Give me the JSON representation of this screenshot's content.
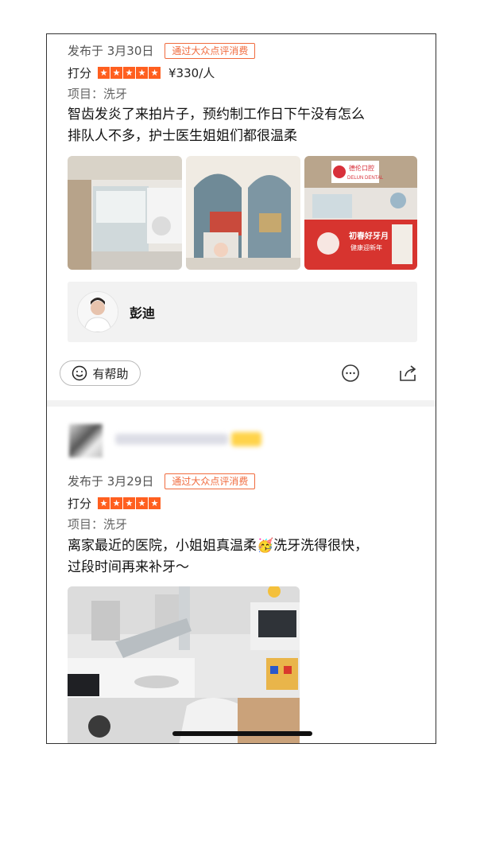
{
  "review1": {
    "date": "发布于 3月30日",
    "source_tag": "通过大众点评消费",
    "score_label": "打分",
    "stars": 5,
    "price": "¥330/人",
    "item": "项目：洗牙",
    "text_line1": "智齿发炎了来拍片子，预约制工作日下午没有怎么",
    "text_line2": "排队人不多，护士医生姐姐们都很温柔",
    "doctor_name": "彭迪",
    "helpful_label": "有帮助",
    "photo_sign_text1": "德伦口腔",
    "photo_sign_text2": "DELUN DENTAL",
    "photo_banner_text1": "初春好牙月",
    "photo_banner_text2": "健康迎新年"
  },
  "review2": {
    "date": "发布于 3月29日",
    "source_tag": "通过大众点评消费",
    "score_label": "打分",
    "stars": 5,
    "item": "项目：洗牙",
    "text_line1": "离家最近的医院，小姐姐真温柔🥳洗牙洗得很快，",
    "text_line2": "过段时间再来补牙～"
  },
  "colors": {
    "accent": "#ff5f1f",
    "tag": "#f06b3e",
    "divider": "#f2f2f2"
  },
  "icons": [
    "star-icon",
    "smile-icon",
    "comment-icon",
    "share-icon"
  ]
}
